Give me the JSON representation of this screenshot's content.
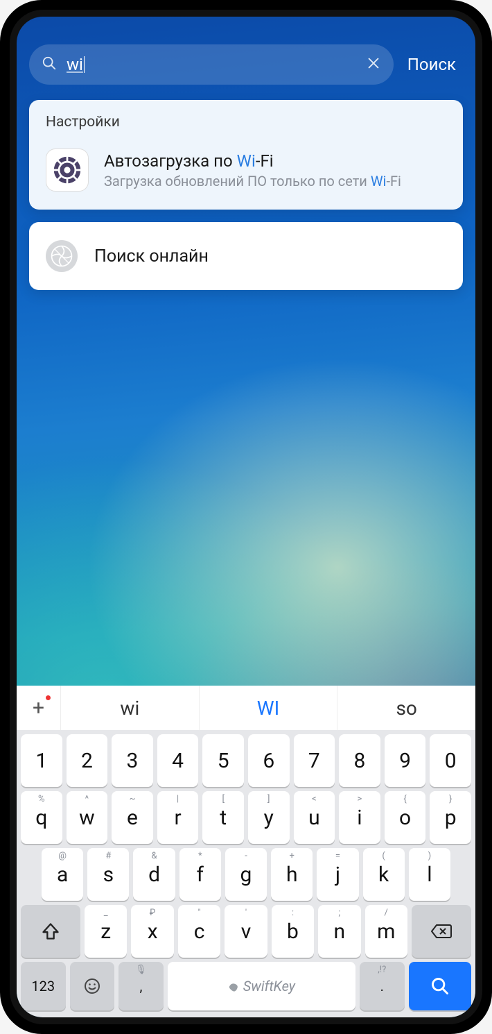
{
  "search": {
    "value": "wi",
    "action_label": "Поиск"
  },
  "results": {
    "section_title": "Настройки",
    "item": {
      "title_pre": "Автозагрузка по ",
      "title_hl": "Wi",
      "title_post": "-Fi",
      "sub_pre": "Загрузка обновлений ПО только по сети ",
      "sub_hl": "Wi",
      "sub_post": "-Fi"
    }
  },
  "online_search_label": "Поиск онлайн",
  "suggestions": {
    "a": "wi",
    "b": "WI",
    "c": "so"
  },
  "keyboard": {
    "row_num": [
      "1",
      "2",
      "3",
      "4",
      "5",
      "6",
      "7",
      "8",
      "9",
      "0"
    ],
    "row1": {
      "main": [
        "q",
        "w",
        "e",
        "r",
        "t",
        "y",
        "u",
        "i",
        "o",
        "p"
      ],
      "sec": [
        "%",
        "^",
        "~",
        "|",
        "[",
        "]",
        "<",
        ">",
        "{",
        "}"
      ]
    },
    "row2": {
      "main": [
        "a",
        "s",
        "d",
        "f",
        "g",
        "h",
        "j",
        "k",
        "l"
      ],
      "sec": [
        "@",
        "#",
        "&",
        "*",
        "-",
        "+",
        "=",
        "(",
        ")"
      ]
    },
    "row3": {
      "main": [
        "z",
        "x",
        "c",
        "v",
        "b",
        "n",
        "m"
      ],
      "sec": [
        "_",
        "₽",
        "\"",
        "'",
        ":",
        ";",
        "/"
      ]
    },
    "bottom": {
      "mode": "123",
      "comma_sec": "🎤",
      "comma": ",",
      "space": "SwiftKey",
      "period": ".",
      "period_sec": ",!?"
    }
  }
}
